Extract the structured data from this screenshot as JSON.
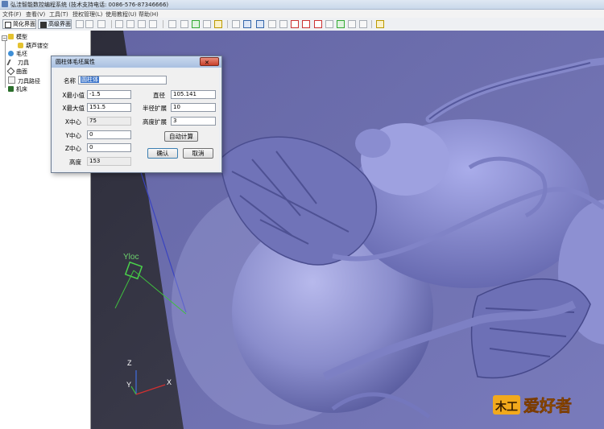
{
  "window": {
    "title": "弘洼智能数控编程系统 (技术支持电话: 0086-576-87346666)"
  },
  "menu": [
    "文件(F)",
    "查看(V)",
    "工具(T)",
    "授权管理(L)",
    "使用教程(U)",
    "帮助(H)"
  ],
  "toolbar": {
    "simple_mode": "简化界面",
    "advanced_mode": "高级界面"
  },
  "tree": {
    "items": [
      {
        "label": "模型"
      },
      {
        "label": "葫芦镂空"
      },
      {
        "label": "毛坯"
      },
      {
        "label": "刀具"
      },
      {
        "label": "曲面"
      },
      {
        "label": "刀具路径"
      },
      {
        "label": "机床"
      }
    ]
  },
  "dialog": {
    "title": "圆柱体毛坯属性",
    "name_label": "名称",
    "name_value": "圆柱体",
    "xmin_label": "X最小值",
    "xmin_value": "-1.5",
    "xmax_label": "X最大值",
    "xmax_value": "151.5",
    "xcenter_label": "X中心",
    "xcenter_value": "75",
    "ycenter_label": "Y中心",
    "ycenter_value": "0",
    "zcenter_label": "Z中心",
    "zcenter_value": "0",
    "height_label": "高度",
    "height_value": "153",
    "diameter_label": "直径",
    "diameter_value": "105.141",
    "radius_ext_label": "半径扩展",
    "radius_ext_value": "10",
    "height_ext_label": "高度扩展",
    "height_ext_value": "3",
    "auto_calc": "自动计算",
    "ok": "确认",
    "cancel": "取消"
  },
  "viewport": {
    "ucs_label": "Yloc",
    "axis_z": "Z",
    "axis_y": "Y",
    "axis_x": "X"
  },
  "watermark": {
    "text": "爱好者",
    "prefix": "木工"
  },
  "colors": {
    "model": "#8c8fcf",
    "background": "#333342",
    "selection": "#3a73c9"
  }
}
